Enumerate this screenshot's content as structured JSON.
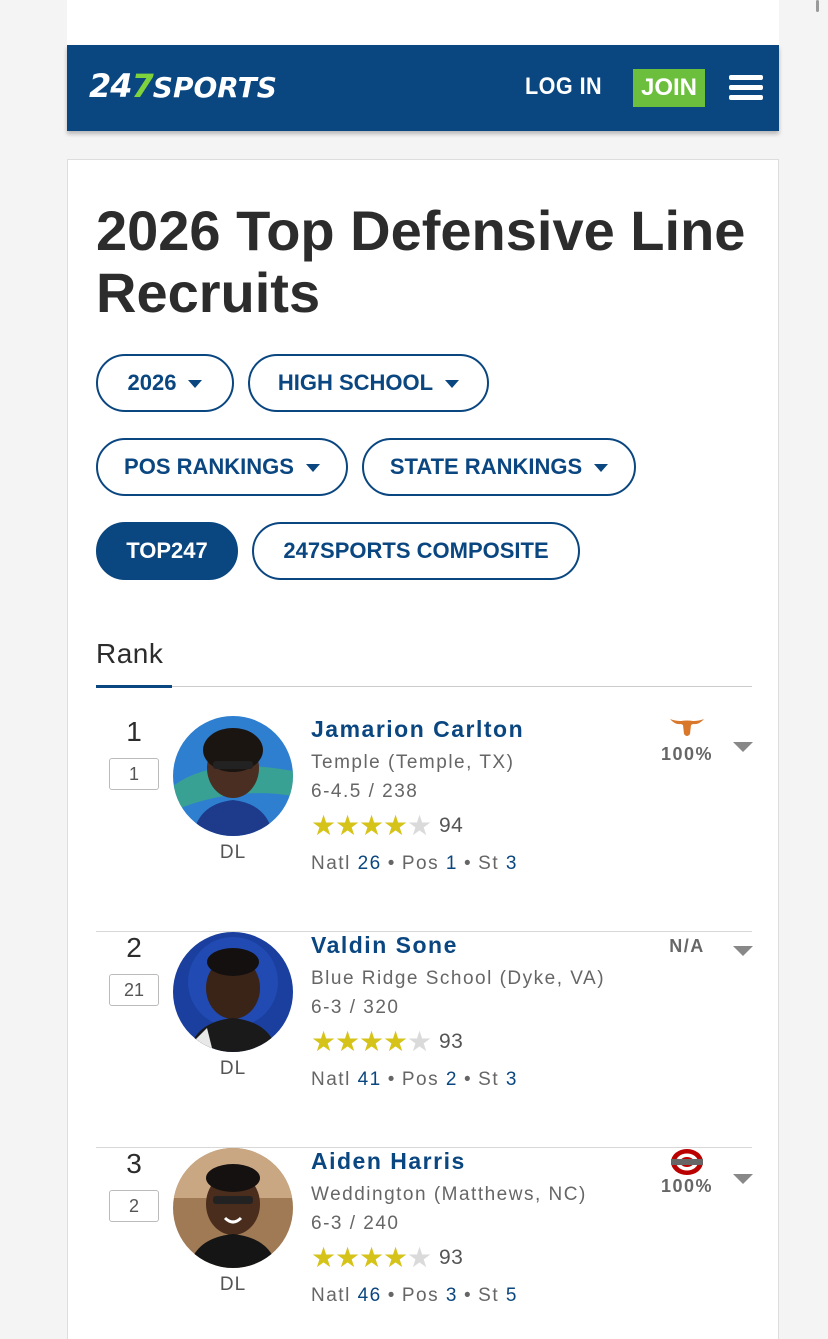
{
  "header": {
    "logo_num": "24",
    "logo_seven": "7",
    "logo_text": "SPORTS",
    "login_label": "LOG IN",
    "join_label": "JOIN"
  },
  "page_title": "2026 Top Defensive Line Recruits",
  "filters": {
    "year": "2026",
    "level": "HIGH SCHOOL",
    "pos_rankings": "POS RANKINGS",
    "state_rankings": "STATE RANKINGS",
    "top247": "TOP247",
    "composite": "247SPORTS COMPOSITE"
  },
  "rank_header": "Rank",
  "colors": {
    "brand_blue": "#0a4680",
    "join_green": "#6cbf3c",
    "star_gold": "#d6c31a"
  },
  "players": [
    {
      "rank": "1",
      "composite_rank": "1",
      "position": "DL",
      "name": "Jamarion Carlton",
      "school": "Temple (Temple, TX)",
      "metrics": "6-4.5 / 238",
      "stars": 4,
      "rating": "94",
      "natl_label": "Natl",
      "natl": "26",
      "pos_label": "Pos",
      "pos": "1",
      "st_label": "St",
      "st": "3",
      "commit_icon": "texas-longhorn-icon",
      "commit_pct": "100%"
    },
    {
      "rank": "2",
      "composite_rank": "21",
      "position": "DL",
      "name": "Valdin Sone",
      "school": "Blue Ridge School (Dyke, VA)",
      "metrics": "6-3 / 320",
      "stars": 4,
      "rating": "93",
      "natl_label": "Natl",
      "natl": "41",
      "pos_label": "Pos",
      "pos": "2",
      "st_label": "St",
      "st": "3",
      "commit_icon": "",
      "commit_pct": "N/A"
    },
    {
      "rank": "3",
      "composite_rank": "2",
      "position": "DL",
      "name": "Aiden Harris",
      "school": "Weddington (Matthews, NC)",
      "metrics": "6-3 / 240",
      "stars": 4,
      "rating": "93",
      "natl_label": "Natl",
      "natl": "46",
      "pos_label": "Pos",
      "pos": "3",
      "st_label": "St",
      "st": "5",
      "commit_icon": "ohio-state-icon",
      "commit_pct": "100%"
    }
  ]
}
